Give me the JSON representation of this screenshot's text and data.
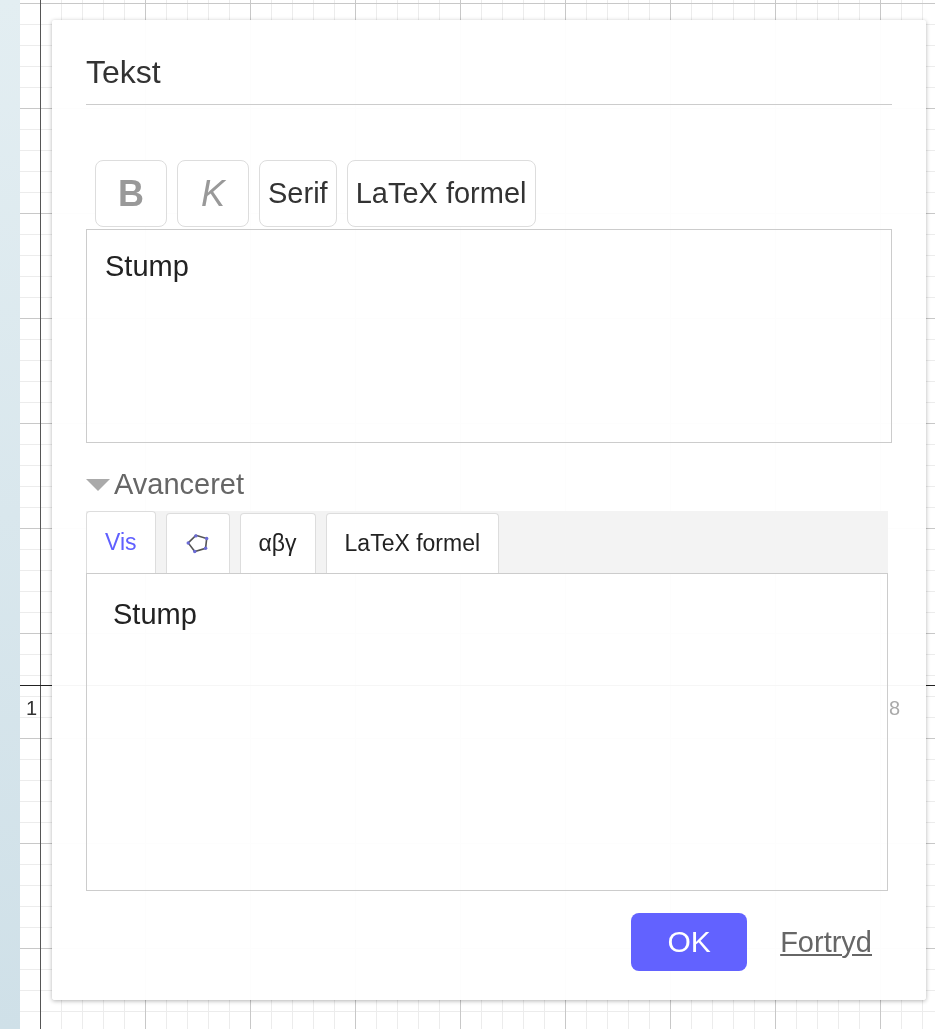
{
  "axis_labels": [
    {
      "text": "1",
      "kind": "left"
    },
    {
      "text": "8",
      "kind": "right"
    }
  ],
  "dialog": {
    "title": "Tekst",
    "toolbar": [
      {
        "label": "B",
        "kind": "bold",
        "selected": false
      },
      {
        "label": "K",
        "kind": "italic",
        "selected": false
      },
      {
        "label": "Serif",
        "kind": "plain",
        "selected": false
      },
      {
        "label": "LaTeX formel",
        "kind": "plain",
        "selected": false
      }
    ],
    "editor_text": "Stump",
    "advanced": {
      "label": "Avanceret",
      "expanded": true,
      "tabs": [
        {
          "label": "Vis",
          "kind": "text",
          "selected": true
        },
        {
          "kind": "polygon",
          "selected": false
        },
        {
          "label": "αβγ",
          "kind": "text",
          "selected": false
        },
        {
          "label": "LaTeX formel",
          "kind": "text",
          "selected": false
        }
      ],
      "preview_text": "Stump"
    },
    "buttons": [
      {
        "label": "OK",
        "kind": "primary"
      },
      {
        "label": "Fortryd",
        "kind": "link"
      }
    ]
  }
}
